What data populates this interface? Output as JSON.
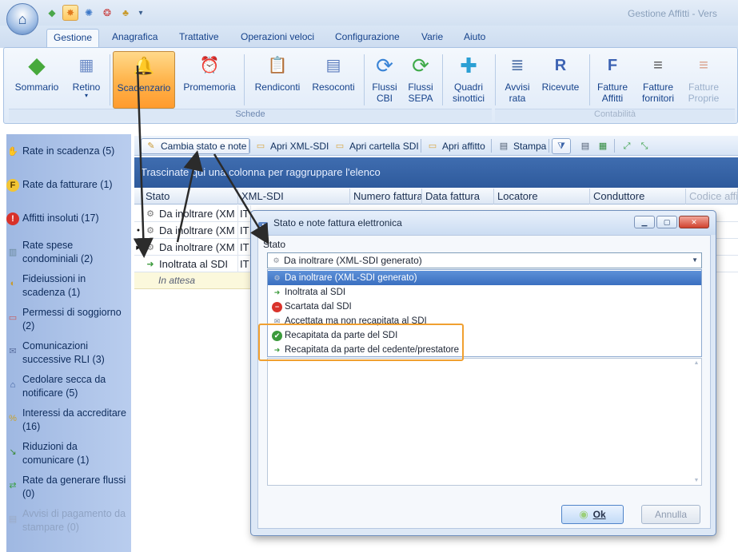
{
  "window": {
    "title": "Gestione Affitti - Vers"
  },
  "quick_access": [
    {
      "icon": "home-icon",
      "color": "#4aa74a"
    },
    {
      "icon": "scadenzario-icon",
      "color": "#e07a1f",
      "active": true
    },
    {
      "icon": "globe-icon",
      "color": "#3c78c8"
    },
    {
      "icon": "ball-icon",
      "color": "#c83c3c"
    },
    {
      "icon": "money-bag-icon",
      "color": "#c89a2c"
    }
  ],
  "ribbon_tabs": [
    "Gestione",
    "Anagrafica",
    "Trattative",
    "Operazioni veloci",
    "Configurazione",
    "Varie",
    "Aiuto"
  ],
  "ribbon": {
    "groups": [
      {
        "label": "Schede"
      },
      {
        "label": "Contabilità"
      }
    ],
    "buttons": [
      {
        "label": "Sommario",
        "icon": "diamond-icon",
        "glyph": "◆",
        "color": "#47a93c"
      },
      {
        "label": "Retino",
        "sub": "▾",
        "icon": "calendar-icon",
        "glyph": "▦",
        "color": "#6d8cc7"
      },
      {
        "label": "Scadenzario",
        "icon": "bell-alert-icon",
        "glyph": "🔔",
        "color": "#d23b2f"
      },
      {
        "label": "Promemoria",
        "icon": "alarm-clock-icon",
        "glyph": "⏰",
        "color": "#c0392b"
      },
      {
        "label": "Rendiconti",
        "icon": "clipboard-icon",
        "glyph": "📋",
        "color": "#c59a3c"
      },
      {
        "label": "Resoconti",
        "icon": "report-window-icon",
        "glyph": "▤",
        "color": "#5a7bbd"
      },
      {
        "label": "Flussi",
        "sub": "CBI",
        "icon": "sync-blue-icon",
        "glyph": "⟳",
        "color": "#3a84d6"
      },
      {
        "label": "Flussi",
        "sub": "SEPA",
        "icon": "sync-green-icon",
        "glyph": "⟳",
        "color": "#3faa4a"
      },
      {
        "label": "Quadri",
        "sub": "sinottici",
        "icon": "puzzle-icon",
        "glyph": "✚",
        "color": "#2b9fd4"
      },
      {
        "label": "Avvisi",
        "sub": "rata",
        "icon": "notice-doc-icon",
        "glyph": "≣",
        "color": "#4d6fa6"
      },
      {
        "label": "Ricevute",
        "icon": "receipt-icon",
        "glyph": "R",
        "color": "#3d63b3"
      },
      {
        "label": "Fatture",
        "sub": "Affitti",
        "icon": "invoice-icon",
        "glyph": "F",
        "color": "#3d63b3"
      },
      {
        "label": "Fatture",
        "sub": "fornitori",
        "icon": "invoice-supplier-icon",
        "glyph": "≡",
        "color": "#555"
      },
      {
        "label": "Fatture",
        "sub": "Proprie",
        "icon": "invoice-own-icon",
        "glyph": "≡",
        "color": "#c9785a"
      }
    ]
  },
  "left_nav": [
    {
      "label": "Rate in scadenza (5)",
      "icon": "money-hand-icon",
      "glyph": "✋",
      "color": "#c98a2a"
    },
    {
      "label": "Rate da fatturare (1)",
      "icon": "invoice-coin-icon",
      "glyph": "F",
      "color": "#d6a41a"
    },
    {
      "label": "Affitti insoluti (17)",
      "icon": "warning-icon",
      "glyph": "!",
      "color": "#d8322a"
    },
    {
      "label": "Rate spese condominiali (2)",
      "icon": "building-icon",
      "glyph": "▥",
      "color": "#6a8a9c"
    },
    {
      "label": "Fideiussioni in scadenza (1)",
      "icon": "shield-clock-icon",
      "glyph": "◐",
      "color": "#c89a2c"
    },
    {
      "label": "Permessi di soggiorno (2)",
      "icon": "id-card-icon",
      "glyph": "▭",
      "color": "#c85a5a"
    },
    {
      "label": "Comunicazioni successive RLI (3)",
      "icon": "letter-icon",
      "glyph": "✉",
      "color": "#5a6fa0"
    },
    {
      "label": "Cedolare secca da notificare (5)",
      "icon": "home-tax-icon",
      "glyph": "⌂",
      "color": "#385b9a"
    },
    {
      "label": "Interessi da accreditare (16)",
      "icon": "interest-icon",
      "glyph": "%",
      "color": "#c9a22c"
    },
    {
      "label": "Riduzioni da comunicare (1)",
      "icon": "reduction-icon",
      "glyph": "↘",
      "color": "#3b8a3a"
    },
    {
      "label": "Rate da generare flussi (0)",
      "icon": "flow-generate-icon",
      "glyph": "⇄",
      "color": "#3aa046"
    },
    {
      "label": "Avvisi di pagamento da stampare (0)",
      "icon": "print-notice-icon",
      "glyph": "🖶",
      "color": "#9aaac4",
      "disabled": true
    }
  ],
  "toolbar": {
    "buttons": [
      {
        "label": "Cambia stato e note",
        "icon": "change-state-icon",
        "glyph": "✎",
        "color": "#c8962c"
      },
      {
        "label": "Apri XML-SDI",
        "icon": "open-xml-icon",
        "glyph": "📄",
        "color": "#d9a640"
      },
      {
        "label": "Apri cartella SDI",
        "icon": "open-folder-icon",
        "glyph": "📁",
        "color": "#d9a640"
      },
      {
        "label": "Apri affitto",
        "icon": "open-rent-icon",
        "glyph": "📂",
        "color": "#d9a640"
      },
      {
        "label": "Stampa",
        "icon": "print-icon",
        "glyph": "🖶",
        "color": "#4d5b70"
      }
    ],
    "extra_icons": [
      "filter-icon",
      "printer-icon",
      "excel-icon",
      "expand-all-icon",
      "collapse-all-icon"
    ]
  },
  "groupbar": {
    "text": "Trascinate qui una colonna per raggruppare l'elenco"
  },
  "grid": {
    "columns": [
      "Stato",
      "XML-SDI",
      "Numero fattura",
      "Data fattura",
      "Locatore",
      "Conduttore",
      "Codice affi"
    ],
    "rows": [
      {
        "stato": "Da inoltrare (XM",
        "xml": "IT",
        "marker": "",
        "icon": "gear-doc-icon"
      },
      {
        "stato": "Da inoltrare (XM",
        "xml": "IT",
        "marker": "●",
        "icon": "gear-doc-icon"
      },
      {
        "stato": "Da inoltrare (XM",
        "xml": "IT",
        "marker": "▶",
        "icon": "gear-doc-icon"
      },
      {
        "stato": "Inoltrata al SDI",
        "xml": "IT",
        "marker": "",
        "icon": "forward-doc-icon"
      }
    ],
    "footer": "In attesa"
  },
  "dialog": {
    "title": "Stato e note fattura elettronica",
    "label": "Stato",
    "selected": "Da inoltrare (XML-SDI generato)",
    "options": [
      {
        "label": "Da inoltrare (XML-SDI generato)",
        "icon": "gear-doc-icon",
        "glyph": "⚙",
        "color": "#8a8f98",
        "selected": true
      },
      {
        "label": "Inoltrata al SDI",
        "icon": "forward-doc-icon",
        "glyph": "➜",
        "color": "#3b9a3b"
      },
      {
        "label": "Scartata dal SDI",
        "icon": "rejected-icon",
        "glyph": "−",
        "color": "#d9332b"
      },
      {
        "label": "Accettata ma non recapitata al SDI",
        "icon": "mail-warning-icon",
        "glyph": "✉",
        "color": "#6f7e96"
      },
      {
        "label": "Recapitata da parte del SDI",
        "icon": "delivered-check-icon",
        "glyph": "✔",
        "color": "#3b9a3b"
      },
      {
        "label": "Recapitata da parte del cedente/prestatore",
        "icon": "delivered-doc-icon",
        "glyph": "➜",
        "color": "#3b9a3b"
      }
    ],
    "ok_label": "Ok",
    "cancel_label": "Annulla"
  },
  "colors": {
    "accent": "#15428b",
    "highlight": "#f0a030",
    "selection": "#3a6fc0",
    "groupbar": "#3f6db0"
  }
}
